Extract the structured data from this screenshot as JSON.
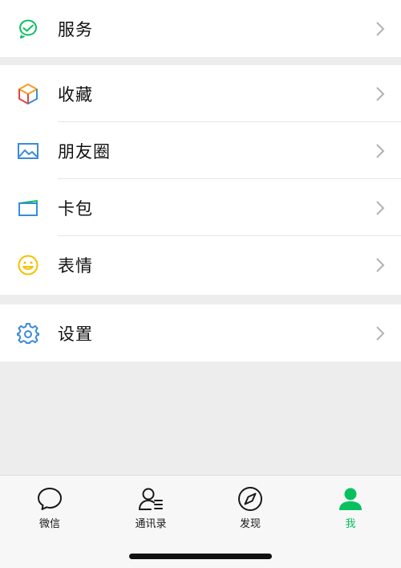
{
  "rows": [
    {
      "label": "服务",
      "icon": "service-icon"
    },
    {
      "label": "收藏",
      "icon": "favorites-icon"
    },
    {
      "label": "朋友圈",
      "icon": "moments-icon"
    },
    {
      "label": "卡包",
      "icon": "card-wallet-icon"
    },
    {
      "label": "表情",
      "icon": "sticker-icon"
    },
    {
      "label": "设置",
      "icon": "gear-icon"
    }
  ],
  "tabs": [
    {
      "label": "微信",
      "icon": "chat-icon"
    },
    {
      "label": "通讯录",
      "icon": "contacts-icon"
    },
    {
      "label": "发现",
      "icon": "compass-icon"
    },
    {
      "label": "我",
      "icon": "person-icon",
      "active": true
    }
  ],
  "colors": {
    "background": "#ededed",
    "accent": "#07c160",
    "chevron": "#b2b2b2",
    "text": "#111111"
  }
}
